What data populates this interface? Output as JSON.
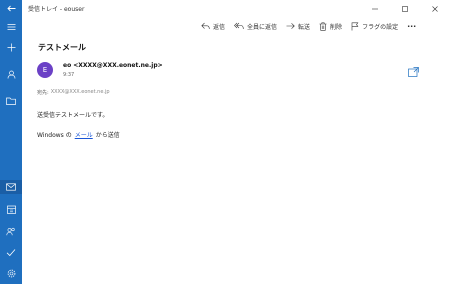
{
  "window": {
    "title": "受信トレイ - eouser"
  },
  "toolbar": {
    "reply": "返信",
    "reply_all": "全員に返信",
    "forward": "転送",
    "delete": "削除",
    "flag": "フラグの設定",
    "more": "···"
  },
  "message": {
    "subject": "テストメール",
    "avatar_initial": "E",
    "sender": "eo <XXXX@XXX.eonet.ne.jp>",
    "time": "9:37",
    "to_label": "宛先:",
    "to_address": "XXXX@XXX.eonet.ne.jp",
    "body_line1": "送受信テストメールです。",
    "body_prefix": "Windows の",
    "body_link": "メール",
    "body_suffix": "から送信"
  },
  "colors": {
    "sidebar": "#1f6fbf",
    "avatar": "#6b41c6",
    "link": "#1a56d6"
  }
}
